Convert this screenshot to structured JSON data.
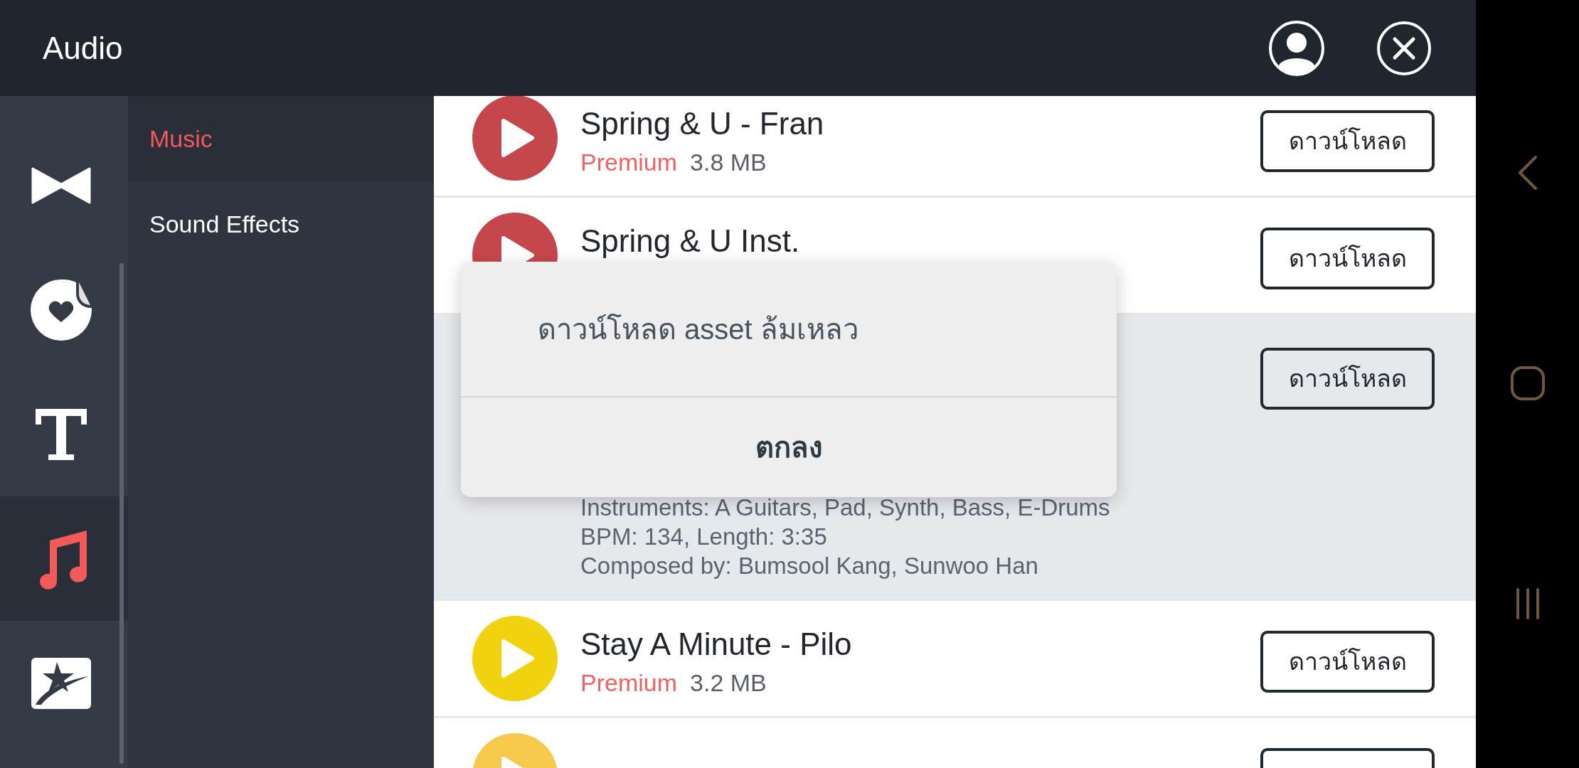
{
  "header": {
    "title": "Audio"
  },
  "rail": [
    {
      "kind": "bowtie",
      "selected": false
    },
    {
      "kind": "sticker",
      "selected": false
    },
    {
      "kind": "text",
      "selected": false
    },
    {
      "kind": "music",
      "selected": true
    },
    {
      "kind": "star",
      "selected": false
    }
  ],
  "categories": [
    {
      "label": "Music",
      "selected": true
    },
    {
      "label": "Sound Effects",
      "selected": false
    }
  ],
  "tracks": [
    {
      "title": "Spring & U - Fran",
      "badge": "Premium",
      "size": "3.8 MB",
      "color": "#c6474b",
      "button": "ดาวน์โหลด",
      "expanded": false
    },
    {
      "title": "Spring & U Inst.",
      "color": "#c6474b",
      "button": "ดาวน์โหลด",
      "expanded": false
    },
    {
      "button": "ดาวน์โหลด",
      "expanded": true,
      "description": [
        "Instruments: A Guitars, Pad, Synth, Bass, E-Drums",
        "BPM: 134, Length: 3:35",
        "Composed by: Bumsool Kang, Sunwoo Han"
      ]
    },
    {
      "title": "Stay A Minute - Pilo",
      "badge": "Premium",
      "size": "3.2 MB",
      "color": "#f1d20e",
      "button": "ดาวน์โหลด",
      "expanded": false
    },
    {
      "color": "#f6c94c",
      "expanded": false
    }
  ],
  "dialog": {
    "message": "ดาวน์โหลด asset ล้มเหลว",
    "button": "ตกลง"
  }
}
